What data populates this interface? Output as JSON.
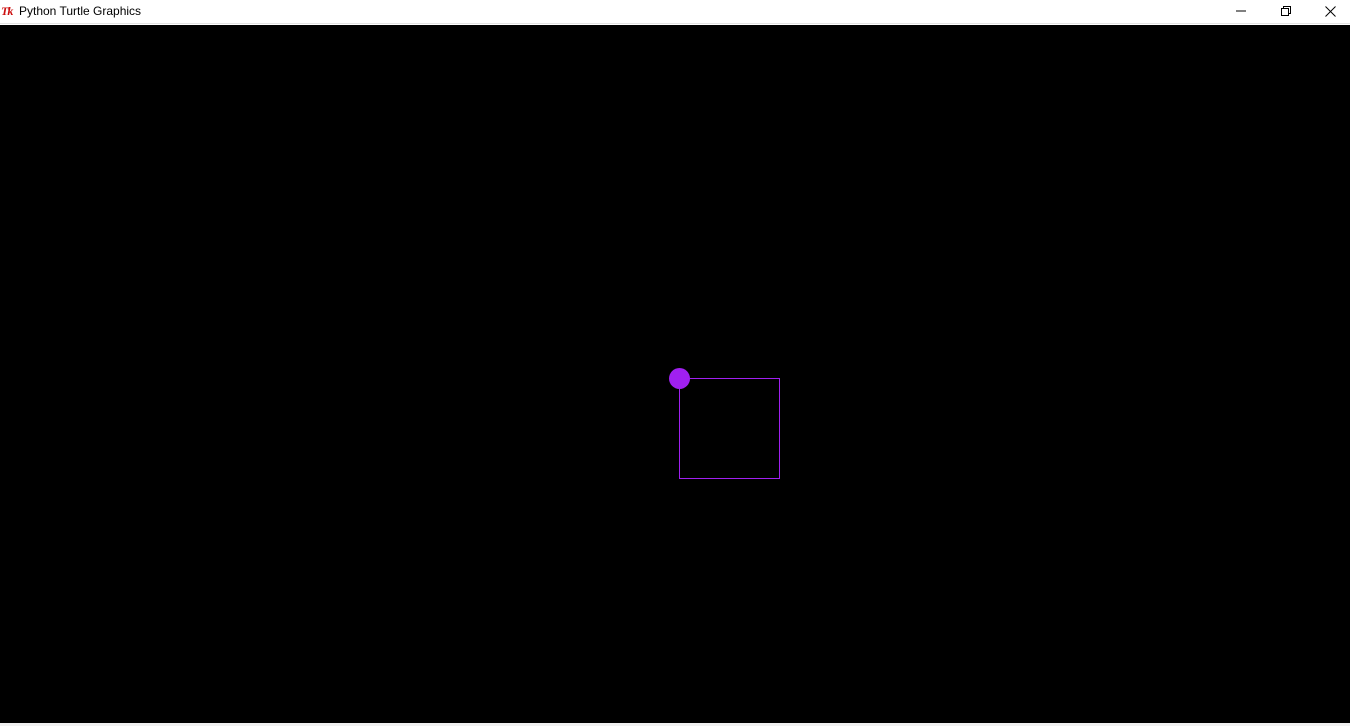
{
  "window": {
    "title": "Python Turtle Graphics",
    "app_icon_text": "Tk",
    "app_icon_color": "#cc1010",
    "controls": {
      "minimize_icon": "minimize-icon",
      "restore_icon": "restore-icon",
      "close_icon": "close-icon"
    }
  },
  "canvas": {
    "background_color": "#000000",
    "drawing": {
      "pen_color": "#a020f0",
      "turtle_color": "#a020f0",
      "turtle_shape": "circle",
      "shape_drawn": "square"
    }
  }
}
